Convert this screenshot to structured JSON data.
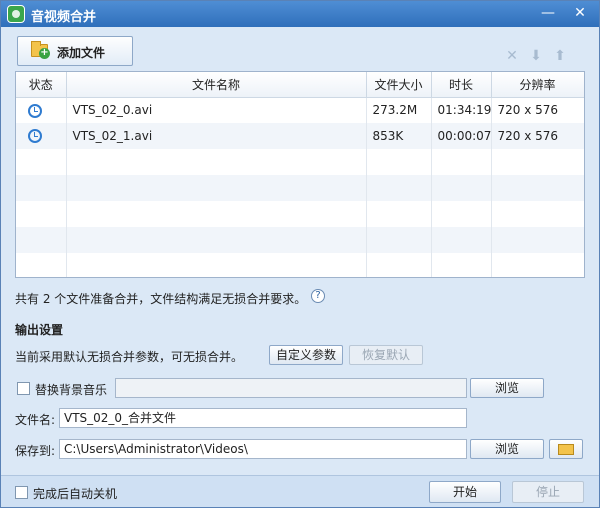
{
  "window": {
    "title": "音视频合并",
    "min_icon": "—",
    "close_icon": "✕"
  },
  "toolbar": {
    "add_label": "添加文件",
    "icons": [
      "remove-icon",
      "move-down-icon",
      "move-up-icon"
    ]
  },
  "table": {
    "headers": [
      "状态",
      "文件名称",
      "文件大小",
      "时长",
      "分辨率"
    ],
    "rows": [
      {
        "status": "clock-icon",
        "name": "VTS_02_0.avi",
        "size": "273.2M",
        "duration": "01:34:19",
        "resolution": "720 x 576"
      },
      {
        "status": "clock-icon",
        "name": "VTS_02_1.avi",
        "size": "853K",
        "duration": "00:00:07",
        "resolution": "720 x 576"
      }
    ]
  },
  "info": {
    "text": "共有 2 个文件准备合并，文件结构满足无损合并要求。",
    "help_icon": "?"
  },
  "output": {
    "title": "输出设置",
    "desc": "当前采用默认无损合并参数，可无损合并。",
    "custom_label": "自定义参数",
    "restore_label": "恢复默认",
    "bgm_label": "替换背景音乐",
    "bgm_value": "",
    "browse1": "浏览",
    "filename_label": "文件名:",
    "filename_value": "VTS_02_0_合并文件",
    "saveto_label": "保存到:",
    "saveto_value": "C:\\Users\\Administrator\\Videos\\",
    "browse2": "浏览"
  },
  "footer": {
    "shutdown_label": "完成后自动关机",
    "start_label": "开始",
    "stop_label": "停止"
  },
  "colors": {
    "accent": "#2f6fbb",
    "background": "#dbe8f6"
  }
}
